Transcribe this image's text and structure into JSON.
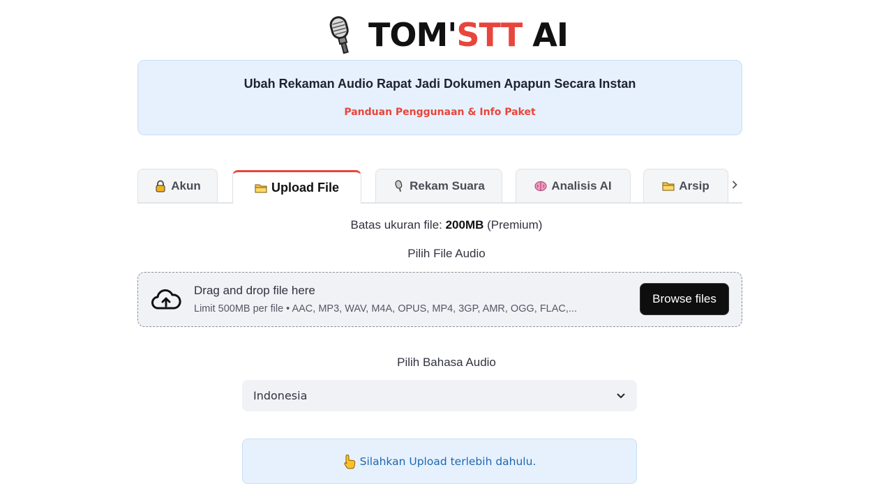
{
  "header": {
    "title_part1": "TOM'",
    "title_accent": "STT",
    "title_part2": " AI",
    "logo_icon": "microphone-icon"
  },
  "banner": {
    "headline": "Ubah Rekaman Audio Rapat Jadi Dokumen Apapun Secara Instan",
    "link": "Panduan Penggunaan & Info Paket"
  },
  "tabs": [
    {
      "label": "Akun",
      "icon": "lock-icon"
    },
    {
      "label": "Upload File",
      "icon": "folder-icon",
      "active": true
    },
    {
      "label": "Rekam Suara",
      "icon": "microphone-icon"
    },
    {
      "label": "Analisis AI",
      "icon": "brain-icon"
    },
    {
      "label": "Arsip",
      "icon": "folder-icon"
    }
  ],
  "upload": {
    "limit_prefix": "Batas ukuran file: ",
    "limit_value": "200MB",
    "limit_suffix": " (Premium)",
    "file_label": "Pilih File Audio",
    "dropzone_title": "Drag and drop file here",
    "dropzone_sub": "Limit 500MB per file • AAC, MP3, WAV, M4A, OPUS, MP4, 3GP, AMR, OGG, FLAC,...",
    "browse_label": "Browse files"
  },
  "language": {
    "label": "Pilih Bahasa Audio",
    "selected": "Indonesia"
  },
  "info": {
    "message": "Silahkan Upload terlebih dahulu."
  },
  "colors": {
    "accent": "#e8453c",
    "banner_bg": "#e6f1fd",
    "info_text": "#1f67b1"
  }
}
